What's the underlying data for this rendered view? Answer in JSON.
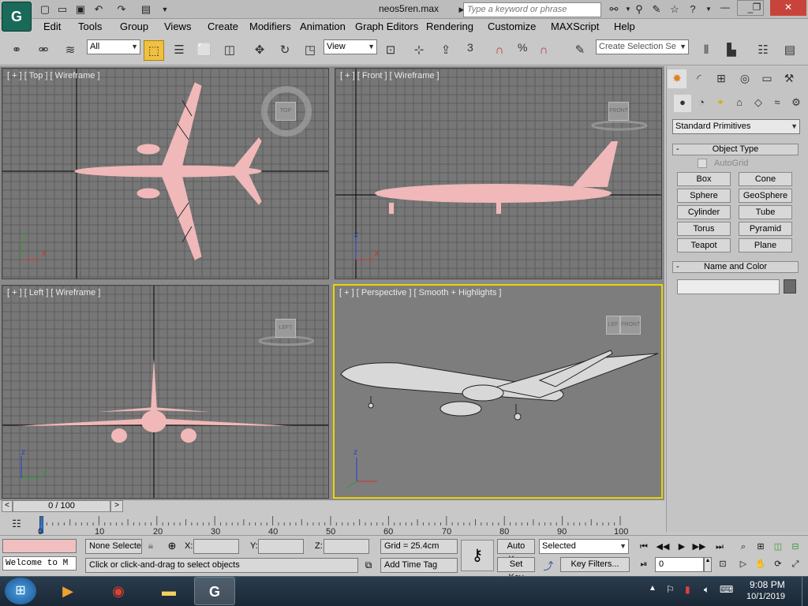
{
  "window": {
    "title": "neos5ren.max",
    "search_placeholder": "Type a keyword or phrase",
    "app_icon": "G"
  },
  "menus": [
    "Edit",
    "Tools",
    "Group",
    "Views",
    "Create",
    "Modifiers",
    "Animation",
    "Graph Editors",
    "Rendering",
    "Customize",
    "MAXScript",
    "Help"
  ],
  "toolbar": {
    "filter": "All",
    "coord_system": "View",
    "snap_value": "3",
    "percent_label": "%",
    "selection_set_placeholder": "Create Selection Se"
  },
  "viewports": {
    "top": {
      "label": "[ + ] [ Top ] [ Wireframe ]",
      "cube": "TOP"
    },
    "front": {
      "label": "[ + ] [ Front ] [ Wireframe ]",
      "cube": "FRONT"
    },
    "left": {
      "label": "[ + ] [ Left ] [ Wireframe ]",
      "cube": "LEFT"
    },
    "perspective": {
      "label": "[ + ] [ Perspective ] [ Smooth + Highlights ]",
      "cube_a": "LEF",
      "cube_b": "FRONT"
    }
  },
  "axes": {
    "x": "x",
    "y": "y",
    "z": "z"
  },
  "command_panel": {
    "category": "Standard Primitives",
    "object_type_title": "Object Type",
    "autogrid": "AutoGrid",
    "buttons": [
      "Box",
      "Cone",
      "Sphere",
      "GeoSphere",
      "Cylinder",
      "Tube",
      "Torus",
      "Pyramid",
      "Teapot",
      "Plane"
    ],
    "name_color_title": "Name and Color",
    "minus": "-"
  },
  "timeline": {
    "frame": "0 / 100",
    "ticks": [
      "0",
      "10",
      "20",
      "30",
      "40",
      "50",
      "60",
      "70",
      "80",
      "90",
      "100"
    ],
    "prev": "<",
    "next": ">"
  },
  "status": {
    "selection": "None Selected",
    "x_label": "X:",
    "y_label": "Y:",
    "z_label": "Z:",
    "grid": "Grid = 25.4cm",
    "auto_key": "Auto Key",
    "set_key": "Set Key",
    "key_mode": "Selected",
    "key_filters": "Key Filters...",
    "frame_value": "0",
    "prompt": "Click or click-and-drag to select objects",
    "add_time_tag": "Add Time Tag",
    "listener": "Welcome to M"
  },
  "taskbar": {
    "time": "9:08 PM",
    "date": "10/1/2019"
  },
  "colors": {
    "mesh": "#f0b8b8",
    "accent": "#e8d400"
  }
}
